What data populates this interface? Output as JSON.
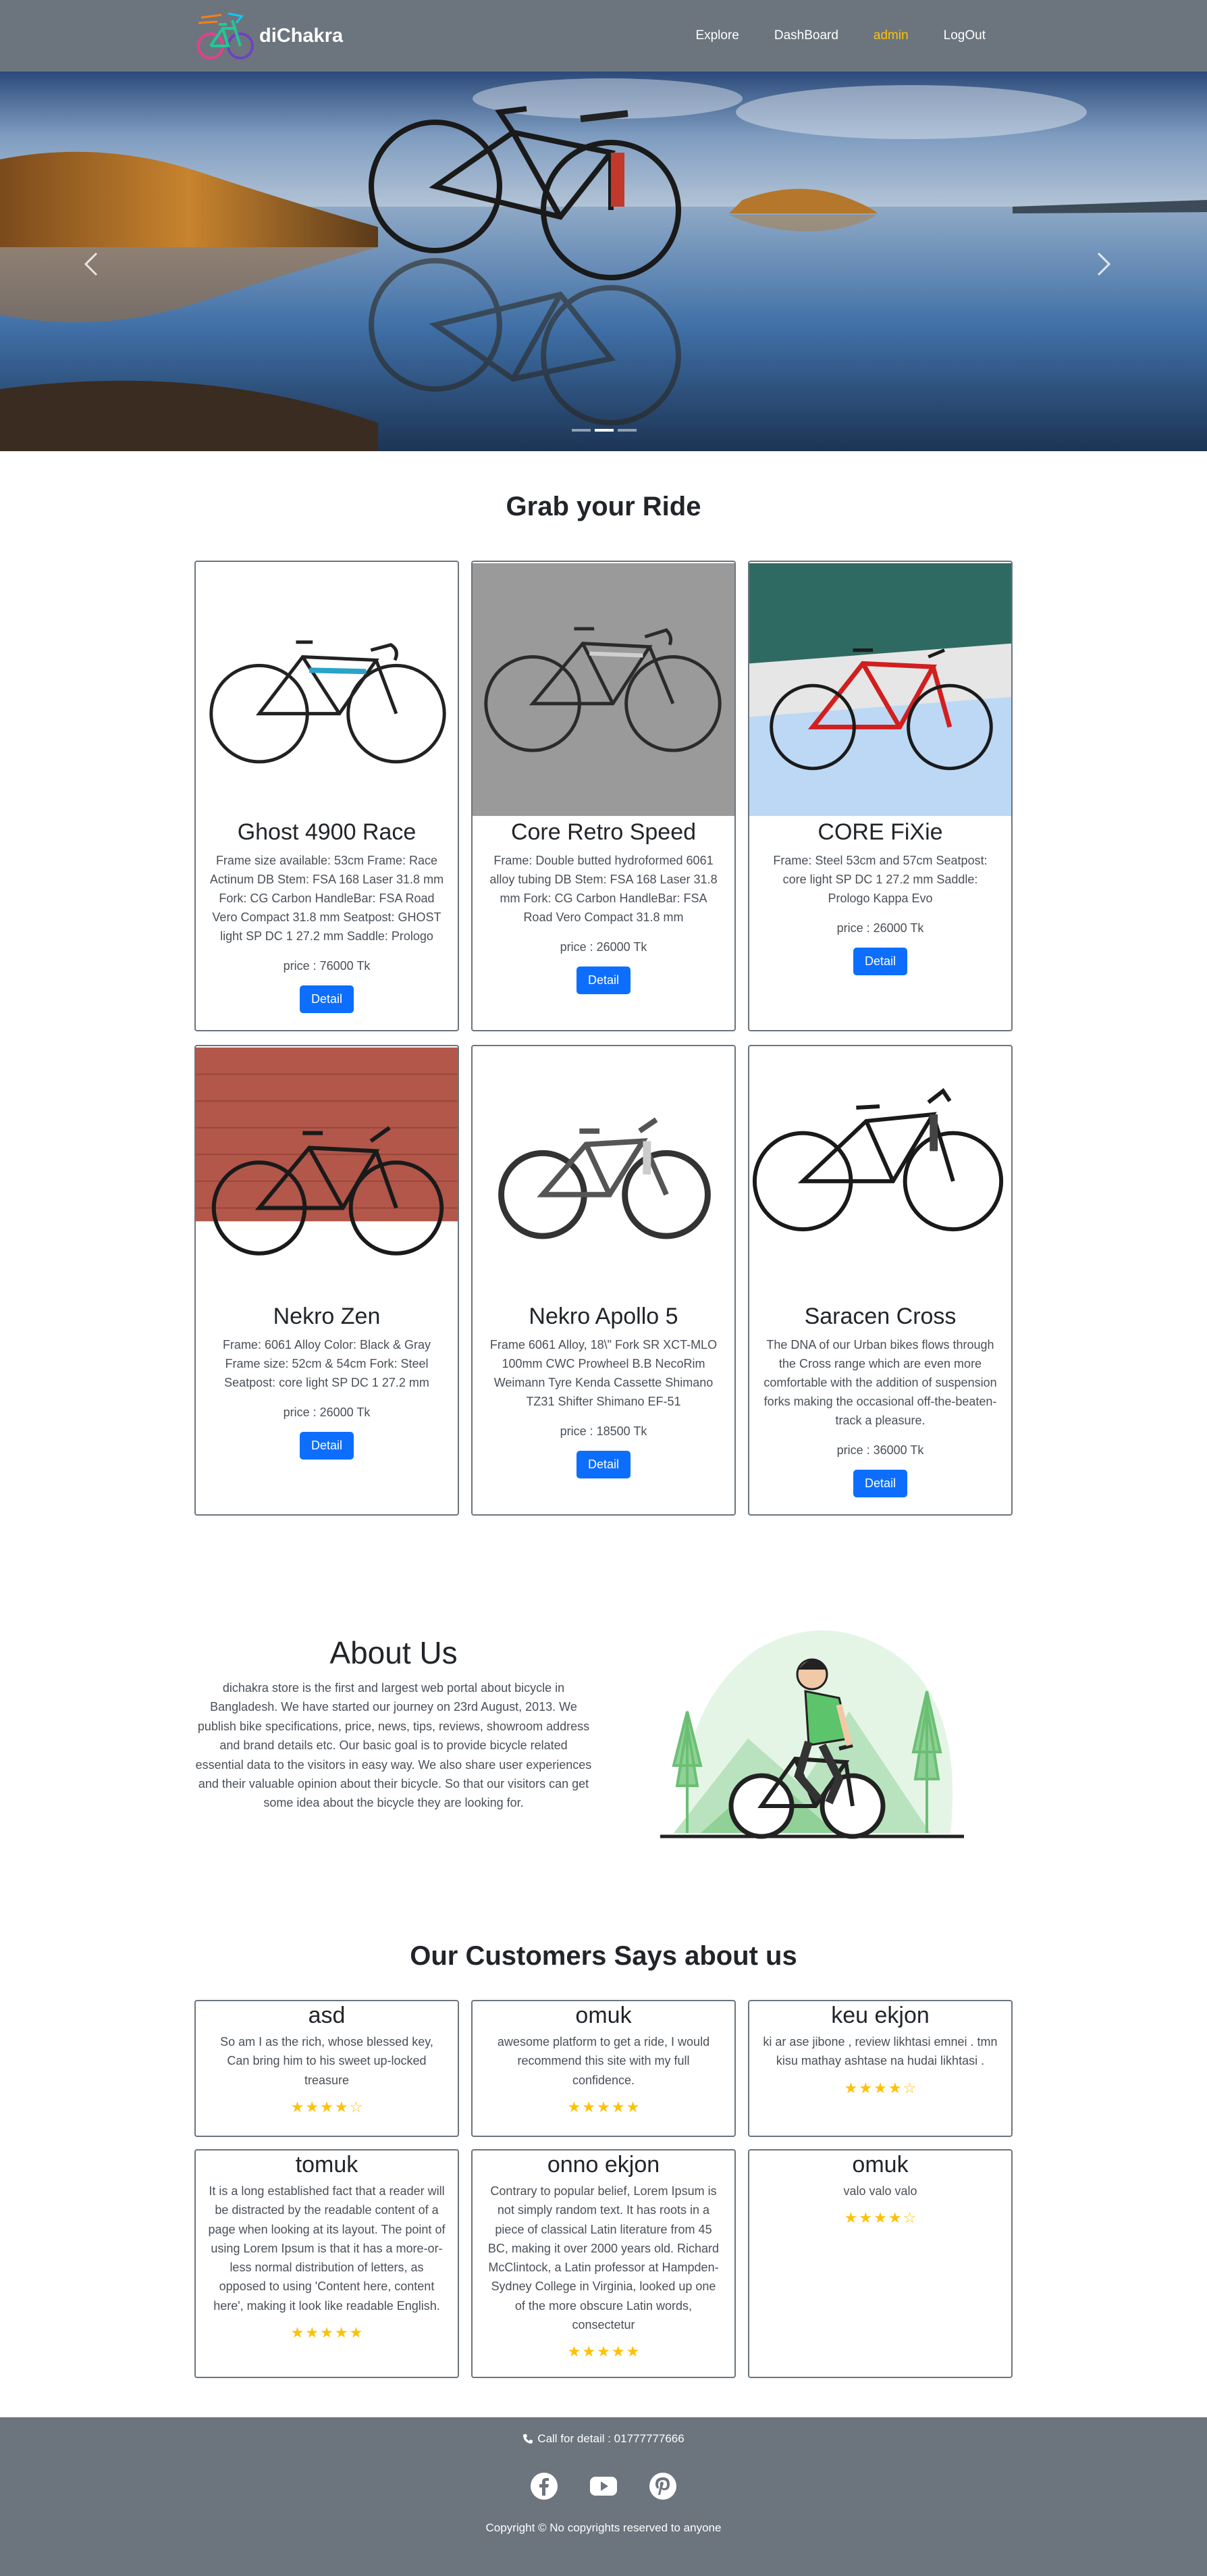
{
  "nav": {
    "brand": "diChakra",
    "links": [
      "Explore",
      "DashBoard",
      "admin",
      "LogOut"
    ]
  },
  "hero": {
    "icons": {
      "prev": "chevron-left-icon",
      "next": "chevron-right-icon"
    },
    "slides": 3,
    "active_slide": 2
  },
  "products": {
    "title": "Grab your Ride",
    "items": [
      {
        "name": "Ghost 4900 Race",
        "desc": "Frame size available: 53cm Frame: Race Actinum DB Stem: FSA 168 Laser 31.8 mm Fork: CG Carbon HandleBar: FSA Road Vero Compact 31.8 mm Seatpost: GHOST light SP DC 1 27.2 mm Saddle: Prologo",
        "price": "price : 76000 Tk",
        "button": "Detail"
      },
      {
        "name": "Core Retro Speed",
        "desc": "Frame: Double butted hydroformed 6061 alloy tubing DB Stem: FSA 168 Laser 31.8 mm Fork: CG Carbon HandleBar: FSA Road Vero Compact 31.8 mm",
        "price": "price : 26000 Tk",
        "button": "Detail"
      },
      {
        "name": "CORE FiXie",
        "desc": "Frame: Steel 53cm and 57cm Seatpost: core light SP DC 1 27.2 mm Saddle: Prologo Kappa Evo",
        "price": "price : 26000 Tk",
        "button": "Detail"
      },
      {
        "name": "Nekro Zen",
        "desc": "Frame: 6061 Alloy Color: Black & Gray Frame size: 52cm & 54cm Fork: Steel Seatpost: core light SP DC 1 27.2 mm",
        "price": "price : 26000 Tk",
        "button": "Detail"
      },
      {
        "name": "Nekro Apollo 5",
        "desc": "Frame 6061 Alloy, 18\\\" Fork SR XCT-MLO 100mm CWC Prowheel B.B NecoRim Weimann Tyre Kenda Cassette Shimano TZ31 Shifter Shimano EF-51",
        "price": "price : 18500 Tk",
        "button": "Detail"
      },
      {
        "name": "Saracen Cross",
        "desc": "The DNA of our Urban bikes flows through the Cross range which are even more comfortable with the addition of suspension forks making the occasional off-the-beaten-track a pleasure.",
        "price": "price : 36000 Tk",
        "button": "Detail"
      }
    ]
  },
  "about": {
    "title": "About Us",
    "body": "dichakra store is the first and largest web portal about bicycle in Bangladesh. We have started our journey on 23rd August, 2013. We publish bike specifications, price, news, tips, reviews, showroom address and brand details etc. Our basic goal is to provide bicycle related essential data to the visitors in easy way. We also share user experiences and their valuable opinion about their bicycle. So that our visitors can get some idea about the bicycle they are looking for."
  },
  "reviews": {
    "title": "Our Customers Says about us",
    "items": [
      {
        "name": "asd",
        "text": "So am I as the rich, whose blessed key, Can bring him to his sweet up-locked treasure",
        "rating": 4
      },
      {
        "name": "omuk",
        "text": "awesome platform to get a ride, I would recommend this site with my full confidence.",
        "rating": 5
      },
      {
        "name": "keu ekjon",
        "text": "ki ar ase jibone , review likhtasi emnei . tmn kisu mathay ashtase na hudai likhtasi .",
        "rating": 4
      },
      {
        "name": "tomuk",
        "text": "It is a long established fact that a reader will be distracted by the readable content of a page when looking at its layout. The point of using Lorem Ipsum is that it has a more-or-less normal distribution of letters, as opposed to using 'Content here, content here', making it look like readable English.",
        "rating": 5
      },
      {
        "name": "onno ekjon",
        "text": "Contrary to popular belief, Lorem Ipsum is not simply random text. It has roots in a piece of classical Latin literature from 45 BC, making it over 2000 years old. Richard McClintock, a Latin professor at Hampden-Sydney College in Virginia, looked up one of the more obscure Latin words, consectetur",
        "rating": 5
      },
      {
        "name": "omuk",
        "text": "valo valo valo",
        "rating": 4
      }
    ]
  },
  "footer": {
    "call": "Call for detail : 01777777666",
    "icons": [
      "phone-icon",
      "facebook-icon",
      "youtube-icon",
      "pinterest-icon"
    ],
    "copyright": "Copyright © No copyrights reserved to anyone"
  },
  "colors": {
    "navbar": "#6c757d",
    "active_link": "#ffc107",
    "button": "#0d6efd",
    "star": "#ffc107",
    "card_border": "#6c757d"
  }
}
